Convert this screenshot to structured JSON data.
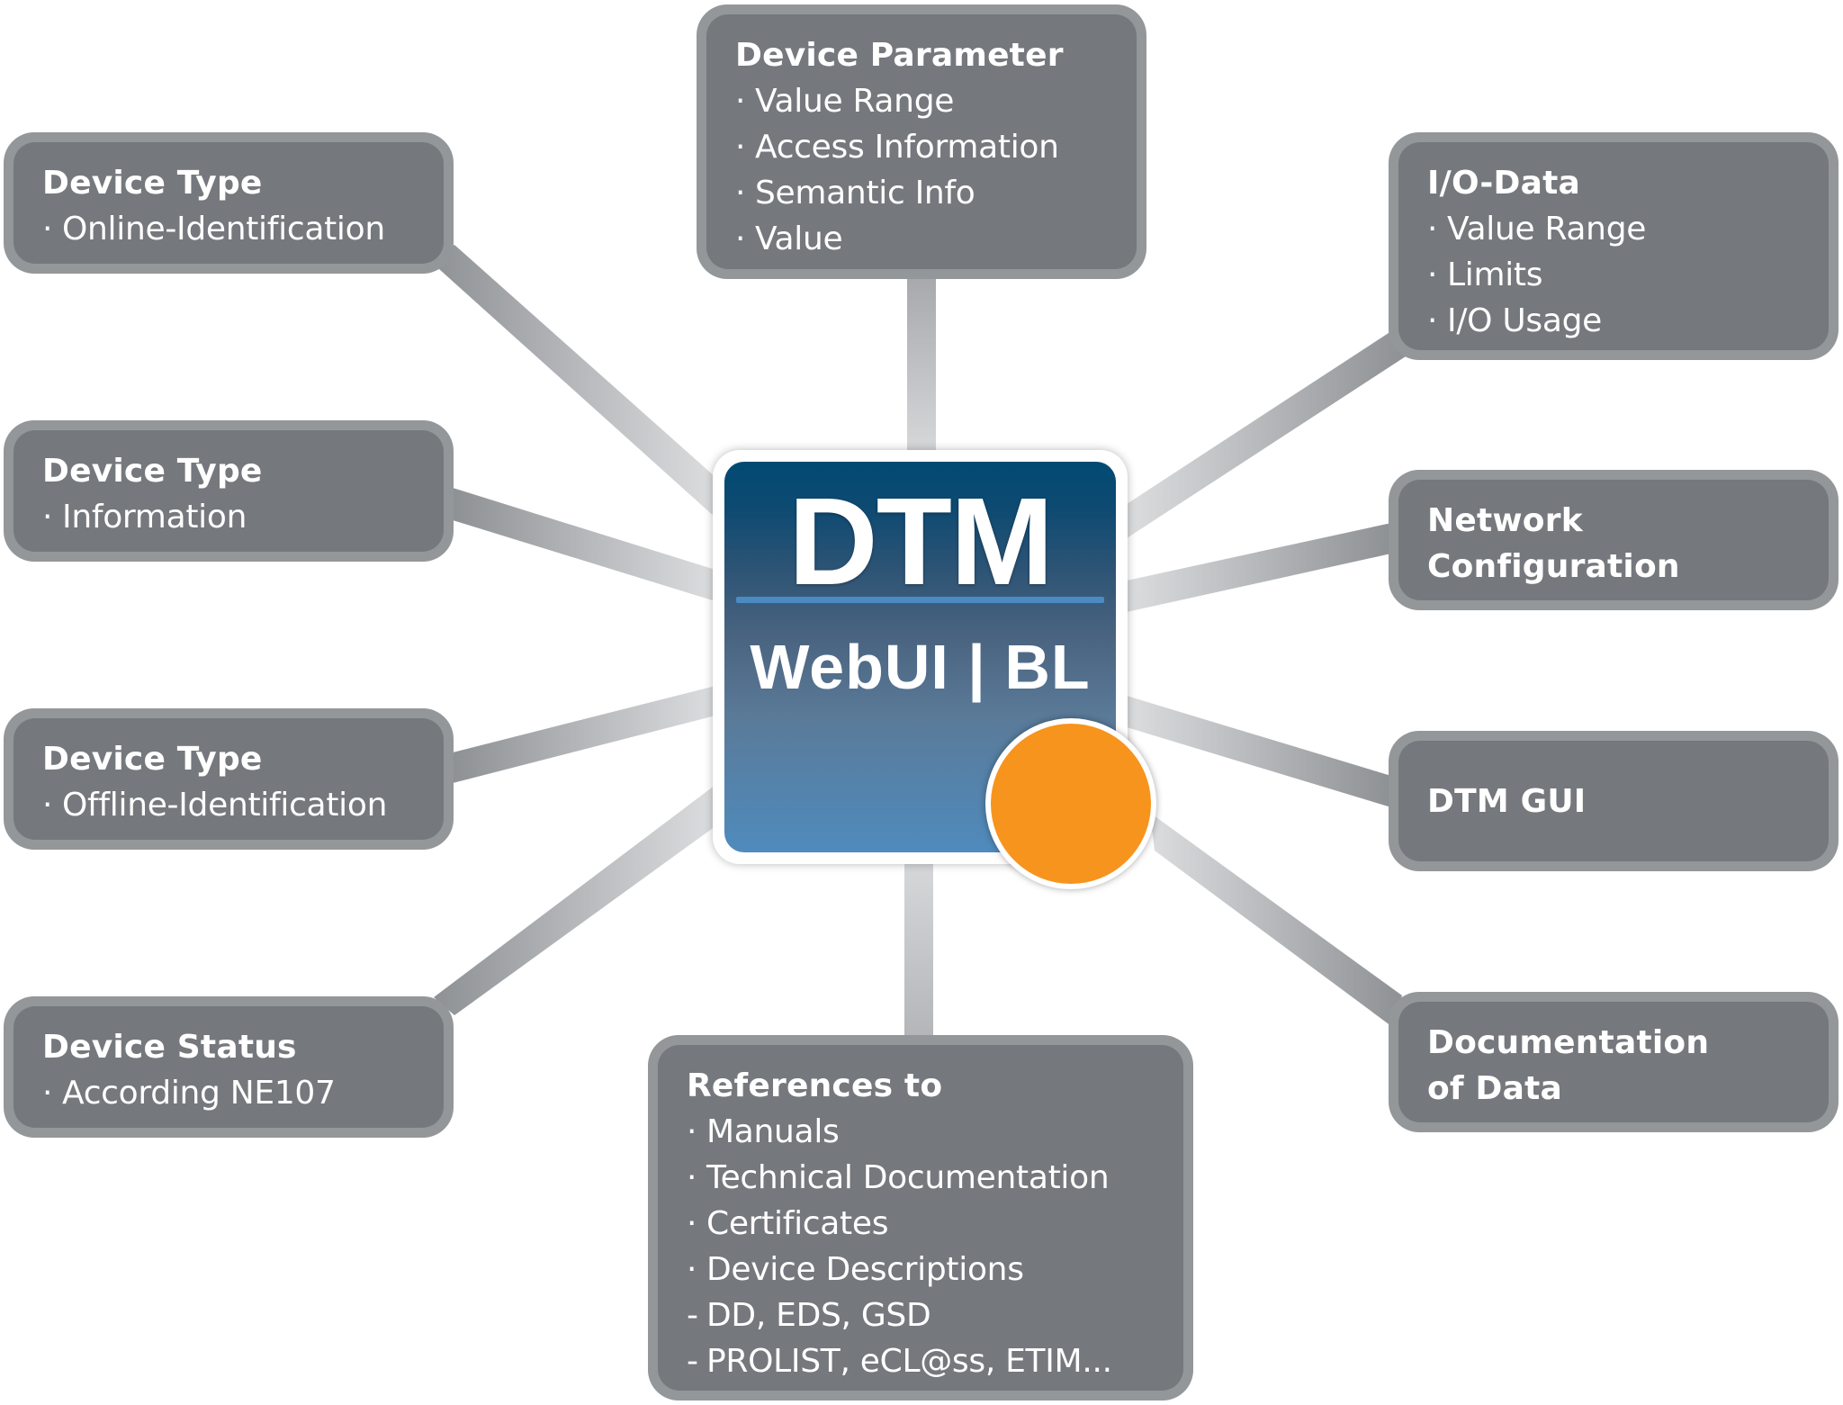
{
  "diagram": {
    "center": {
      "title": "DTM",
      "subtitle": "WebUI | BL",
      "card_gradient_top": "#014a72",
      "card_gradient_bottom": "#4f8bbd",
      "divider_color": "#4b8bc4",
      "status_dot_color": "#f7941d"
    },
    "colors": {
      "node_border": "#94979a",
      "node_fill": "#75787c",
      "node_text": "#ffffff",
      "connector_dark": "#8e9194",
      "connector_light": "#dcdddf"
    },
    "nodes": [
      {
        "id": "device-type-online",
        "title": "Device Type",
        "items": [
          {
            "bullet": "·",
            "text": "Online-Identification"
          }
        ]
      },
      {
        "id": "device-type-information",
        "title": "Device Type",
        "items": [
          {
            "bullet": "·",
            "text": "Information"
          }
        ]
      },
      {
        "id": "device-type-offline",
        "title": "Device Type",
        "items": [
          {
            "bullet": "·",
            "text": "Offline-Identification"
          }
        ]
      },
      {
        "id": "device-status",
        "title": "Device Status",
        "items": [
          {
            "bullet": "·",
            "text": "According NE107"
          }
        ]
      },
      {
        "id": "device-parameter",
        "title": "Device Parameter",
        "items": [
          {
            "bullet": "·",
            "text": "Value Range"
          },
          {
            "bullet": "·",
            "text": "Access Information"
          },
          {
            "bullet": "·",
            "text": "Semantic Info"
          },
          {
            "bullet": "·",
            "text": "Value"
          }
        ]
      },
      {
        "id": "references",
        "title": "References to",
        "items": [
          {
            "bullet": "·",
            "text": "Manuals"
          },
          {
            "bullet": "·",
            "text": "Technical Documentation"
          },
          {
            "bullet": "·",
            "text": "Certificates"
          },
          {
            "bullet": "·",
            "text": "Device Descriptions"
          },
          {
            "bullet": "-",
            "text": "DD, EDS, GSD"
          },
          {
            "bullet": "-",
            "text": "PROLIST, eCL@ss, ETIM..."
          }
        ]
      },
      {
        "id": "io-data",
        "title": "I/O-Data",
        "items": [
          {
            "bullet": "·",
            "text": "Value Range"
          },
          {
            "bullet": "·",
            "text": "Limits"
          },
          {
            "bullet": "·",
            "text": "I/O Usage"
          }
        ]
      },
      {
        "id": "network-configuration",
        "title": "Network\nConfiguration",
        "items": []
      },
      {
        "id": "dtm-gui",
        "title": "DTM GUI",
        "items": []
      },
      {
        "id": "documentation-of-data",
        "title": "Documentation\nof Data",
        "items": []
      }
    ]
  }
}
